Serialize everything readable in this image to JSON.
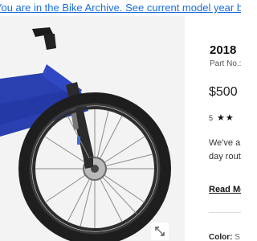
{
  "banner": {
    "text": "You are in the Bike Archive. See current model year bikes here"
  },
  "product": {
    "title": "2018",
    "part_label": "Part No.:",
    "price": "$500",
    "rating_count": "5",
    "stars_glyph": "★★",
    "description_line1": "We've a",
    "description_line2": "day rout",
    "read_more": "Read Mo",
    "color_label": "Color:",
    "color_value": "S"
  },
  "image": {
    "alt_icon": "bike-photo",
    "zoom_icon": "expand-icon"
  },
  "colors": {
    "frame": "#2a3fb0",
    "link": "#1a6ed8"
  }
}
